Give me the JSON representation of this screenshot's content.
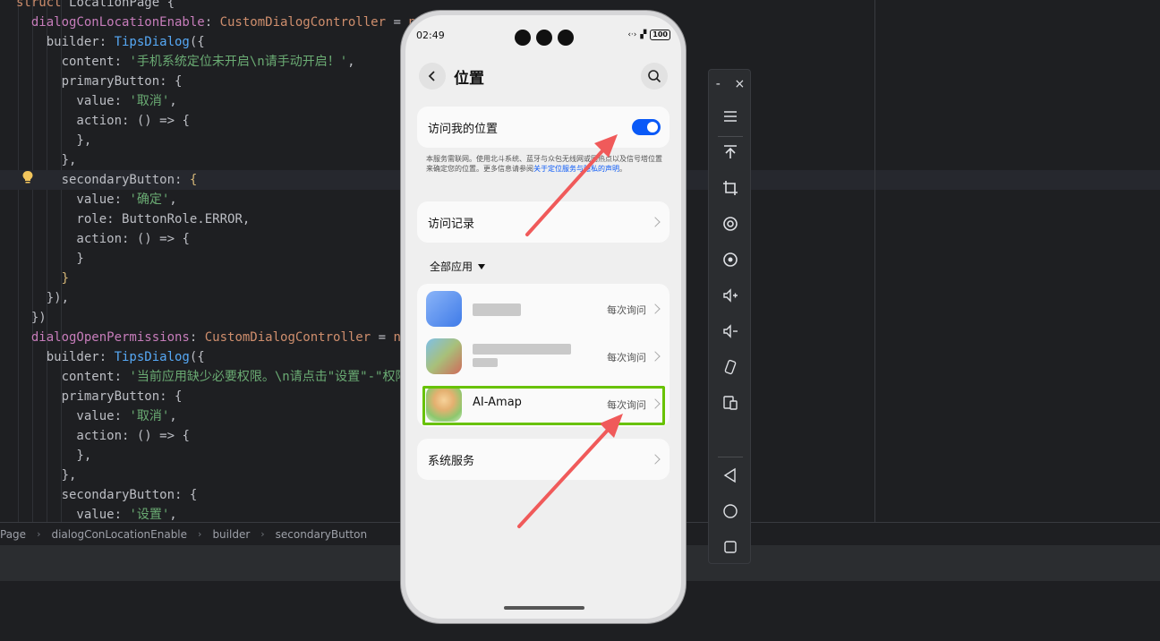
{
  "editor": {
    "lines": [
      [
        {
          "t": "struct ",
          "c": "kw"
        },
        {
          "t": "LocationPage ",
          "c": "plain"
        },
        {
          "t": "{",
          "c": "plain"
        }
      ],
      [
        {
          "t": "  dialogConLocationEnable",
          "c": "prop"
        },
        {
          "t": ": ",
          "c": "plain"
        },
        {
          "t": "CustomDialogController",
          "c": "kw"
        },
        {
          "t": " = ",
          "c": "plain"
        },
        {
          "t": "new",
          "c": "kw"
        }
      ],
      [
        {
          "t": "    builder",
          "c": "plain"
        },
        {
          "t": ": ",
          "c": "plain"
        },
        {
          "t": "TipsDialog",
          "c": "fn"
        },
        {
          "t": "({",
          "c": "plain"
        }
      ],
      [
        {
          "t": "      content",
          "c": "plain"
        },
        {
          "t": ": ",
          "c": "plain"
        },
        {
          "t": "'手机系统定位未开启\\n请手动开启！'",
          "c": "str"
        },
        {
          "t": ",",
          "c": "plain"
        }
      ],
      [
        {
          "t": "      primaryButton",
          "c": "plain"
        },
        {
          "t": ": {",
          "c": "plain"
        }
      ],
      [
        {
          "t": "        value",
          "c": "plain"
        },
        {
          "t": ": ",
          "c": "plain"
        },
        {
          "t": "'取消'",
          "c": "str"
        },
        {
          "t": ",",
          "c": "plain"
        }
      ],
      [
        {
          "t": "        action",
          "c": "plain"
        },
        {
          "t": ": () => {",
          "c": "plain"
        }
      ],
      [
        {
          "t": "        },",
          "c": "plain"
        }
      ],
      [
        {
          "t": "      },",
          "c": "plain"
        }
      ],
      [
        {
          "t": "      secondaryButton",
          "c": "plain"
        },
        {
          "t": ": ",
          "c": "plain"
        },
        {
          "t": "{",
          "c": "brace"
        }
      ],
      [
        {
          "t": "        value",
          "c": "plain"
        },
        {
          "t": ": ",
          "c": "plain"
        },
        {
          "t": "'确定'",
          "c": "str"
        },
        {
          "t": ",",
          "c": "plain"
        }
      ],
      [
        {
          "t": "        role",
          "c": "plain"
        },
        {
          "t": ": ButtonRole.ERROR,",
          "c": "plain"
        }
      ],
      [
        {
          "t": "        action",
          "c": "plain"
        },
        {
          "t": ": () => {",
          "c": "plain"
        }
      ],
      [
        {
          "t": "        }",
          "c": "plain"
        }
      ],
      [
        {
          "t": "      }",
          "c": "brace"
        }
      ],
      [
        {
          "t": "    }),",
          "c": "plain"
        }
      ],
      [
        {
          "t": "  })",
          "c": "plain"
        }
      ],
      [
        {
          "t": "  dialogOpenPermissions",
          "c": "prop"
        },
        {
          "t": ": ",
          "c": "plain"
        },
        {
          "t": "CustomDialogController",
          "c": "kw"
        },
        {
          "t": " = ",
          "c": "plain"
        },
        {
          "t": "new",
          "c": "kw"
        }
      ],
      [
        {
          "t": "    builder",
          "c": "plain"
        },
        {
          "t": ": ",
          "c": "plain"
        },
        {
          "t": "TipsDialog",
          "c": "fn"
        },
        {
          "t": "({",
          "c": "plain"
        }
      ],
      [
        {
          "t": "      content",
          "c": "plain"
        },
        {
          "t": ": ",
          "c": "plain"
        },
        {
          "t": "'当前应用缺少必要权限。\\n请点击\"设置\"-\"权限\"-打",
          "c": "str"
        }
      ],
      [
        {
          "t": "      primaryButton",
          "c": "plain"
        },
        {
          "t": ": {",
          "c": "plain"
        }
      ],
      [
        {
          "t": "        value",
          "c": "plain"
        },
        {
          "t": ": ",
          "c": "plain"
        },
        {
          "t": "'取消'",
          "c": "str"
        },
        {
          "t": ",",
          "c": "plain"
        }
      ],
      [
        {
          "t": "        action",
          "c": "plain"
        },
        {
          "t": ": () => {",
          "c": "plain"
        }
      ],
      [
        {
          "t": "        },",
          "c": "plain"
        }
      ],
      [
        {
          "t": "      },",
          "c": "plain"
        }
      ],
      [
        {
          "t": "      secondaryButton",
          "c": "plain"
        },
        {
          "t": ": {",
          "c": "plain"
        }
      ],
      [
        {
          "t": "        value",
          "c": "plain"
        },
        {
          "t": ": ",
          "c": "plain"
        },
        {
          "t": "'设置'",
          "c": "str"
        },
        {
          "t": ",",
          "c": "plain"
        }
      ]
    ]
  },
  "breadcrumb": {
    "items": [
      "Page",
      "dialogConLocationEnable",
      "builder",
      "secondaryButton"
    ],
    "sep": "›"
  },
  "phone": {
    "time": "02:49",
    "battery": "100",
    "signal": "‹·›",
    "title": "位置",
    "location_toggle_label": "访问我的位置",
    "location_toggle_on": true,
    "desc_text": "本服务需联网。使用北斗系统、蓝牙与众包无线网或网热点以及信号塔位置来确定您的位置。更多信息请参阅",
    "desc_link": "关于定位服务与隐私的声明",
    "desc_end": "。",
    "history_label": "访问记录",
    "filter_label": "全部应用",
    "apps": [
      {
        "name": "",
        "status": "每次询问"
      },
      {
        "name": "",
        "status": "每次询问"
      },
      {
        "name": "AI-Amap",
        "status": "每次询问"
      }
    ],
    "system_services_label": "系统服务"
  },
  "toolbar": {
    "minimize": "-",
    "close": "×",
    "items": [
      "menu-icon",
      "move-to-top-icon",
      "crop-icon",
      "rotate-screen-icon",
      "screenshot-icon",
      "volume-up-icon",
      "volume-down-icon",
      "rotate-device-icon",
      "multi-device-icon",
      "back-icon",
      "home-icon",
      "recent-apps-icon"
    ]
  },
  "colors": {
    "accent": "#0a59f7",
    "highlight": "#68c200",
    "arrow": "#f05a5a"
  }
}
